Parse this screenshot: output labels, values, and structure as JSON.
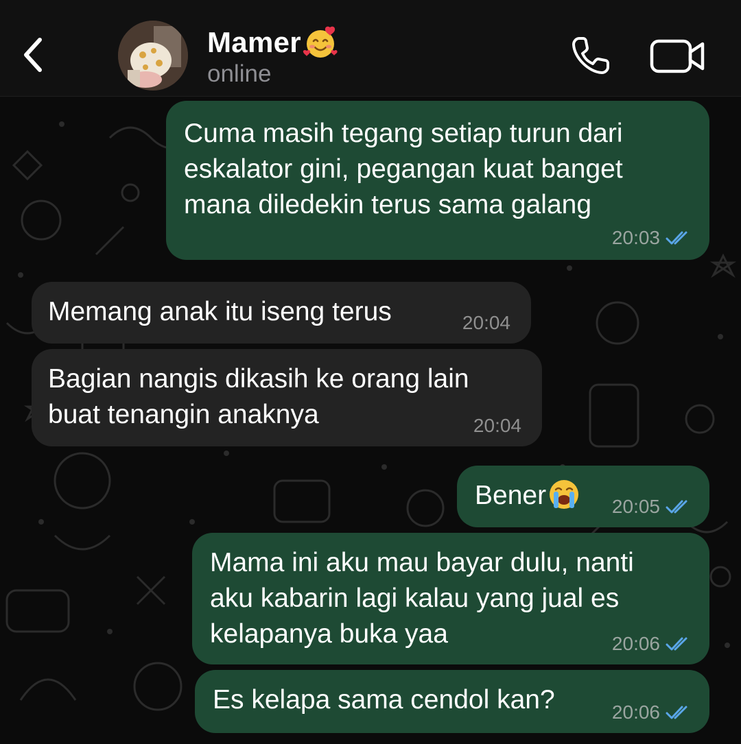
{
  "header": {
    "contact_name": "Mamer",
    "name_emoji": "smiling-face-with-hearts",
    "status": "online",
    "back_icon": "chevron-left-icon",
    "call_icon": "phone-icon",
    "video_icon": "video-camera-icon"
  },
  "colors": {
    "outgoing_bubble": "#1e4a34",
    "incoming_bubble": "#232323",
    "read_ticks": "#5aa6e8",
    "background": "#0b0b0b"
  },
  "messages": [
    {
      "direction": "out",
      "text": "Cuma masih tegang setiap turun dari\neskalator gini, pegangan kuat banget\nmana diledekin terus sama galang",
      "time": "20:03",
      "status": "read"
    },
    {
      "direction": "in",
      "text": "Memang anak itu iseng terus",
      "time": "20:04"
    },
    {
      "direction": "in",
      "text": "Bagian nangis dikasih ke orang lain\nbuat tenangin anaknya",
      "time": "20:04"
    },
    {
      "direction": "out",
      "text": "Bener",
      "emoji": "loudly-crying-face",
      "time": "20:05",
      "status": "read"
    },
    {
      "direction": "out",
      "text": "Mama ini aku mau bayar dulu, nanti\naku kabarin lagi kalau yang jual es\nkelapanya buka yaa",
      "time": "20:06",
      "status": "read"
    },
    {
      "direction": "out",
      "text": "Es kelapa sama cendol kan?",
      "time": "20:06",
      "status": "read"
    }
  ]
}
